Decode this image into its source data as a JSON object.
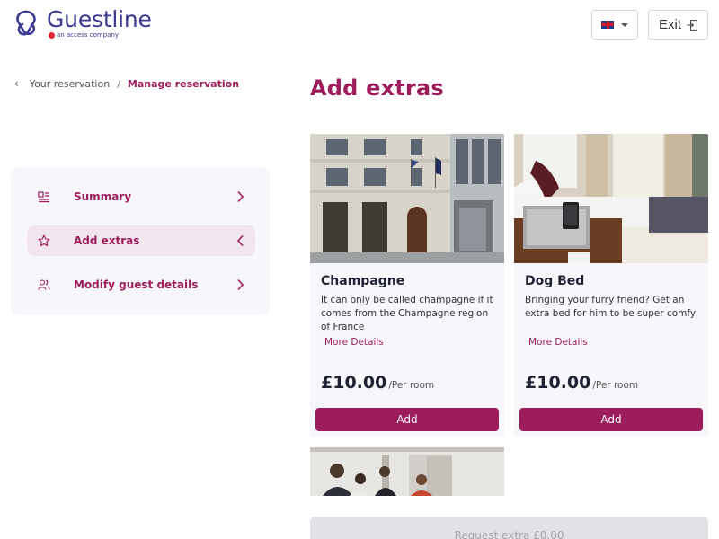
{
  "header": {
    "brand": "Guestline",
    "brand_sub": "an access company",
    "language_flag": "uk-flag-icon",
    "exit_label": "Exit"
  },
  "breadcrumb": {
    "items": [
      "Your reservation",
      "Manage reservation"
    ],
    "separator": "/"
  },
  "nav": {
    "items": [
      {
        "label": "Summary",
        "icon": "summary-icon",
        "active": false
      },
      {
        "label": "Add extras",
        "icon": "star-icon",
        "active": true
      },
      {
        "label": "Modify guest details",
        "icon": "users-icon",
        "active": false
      }
    ]
  },
  "main": {
    "title": "Add extras",
    "cards": [
      {
        "title": "Champagne",
        "description": "It can only be called champagne if it comes from the Champagne region of France",
        "more": "More Details",
        "price": "£10.00",
        "unit": "/Per room",
        "button": "Add"
      },
      {
        "title": "Dog Bed",
        "description": "Bringing your furry friend? Get an extra bed for him to be super comfy",
        "more": "More Details",
        "price": "£10.00",
        "unit": "/Per room",
        "button": "Add"
      }
    ],
    "request_button": "Request extra £0.00"
  },
  "colors": {
    "brand": "#9c1c5c",
    "logo": "#3b3a8f",
    "panel": "#f6f6fb"
  }
}
